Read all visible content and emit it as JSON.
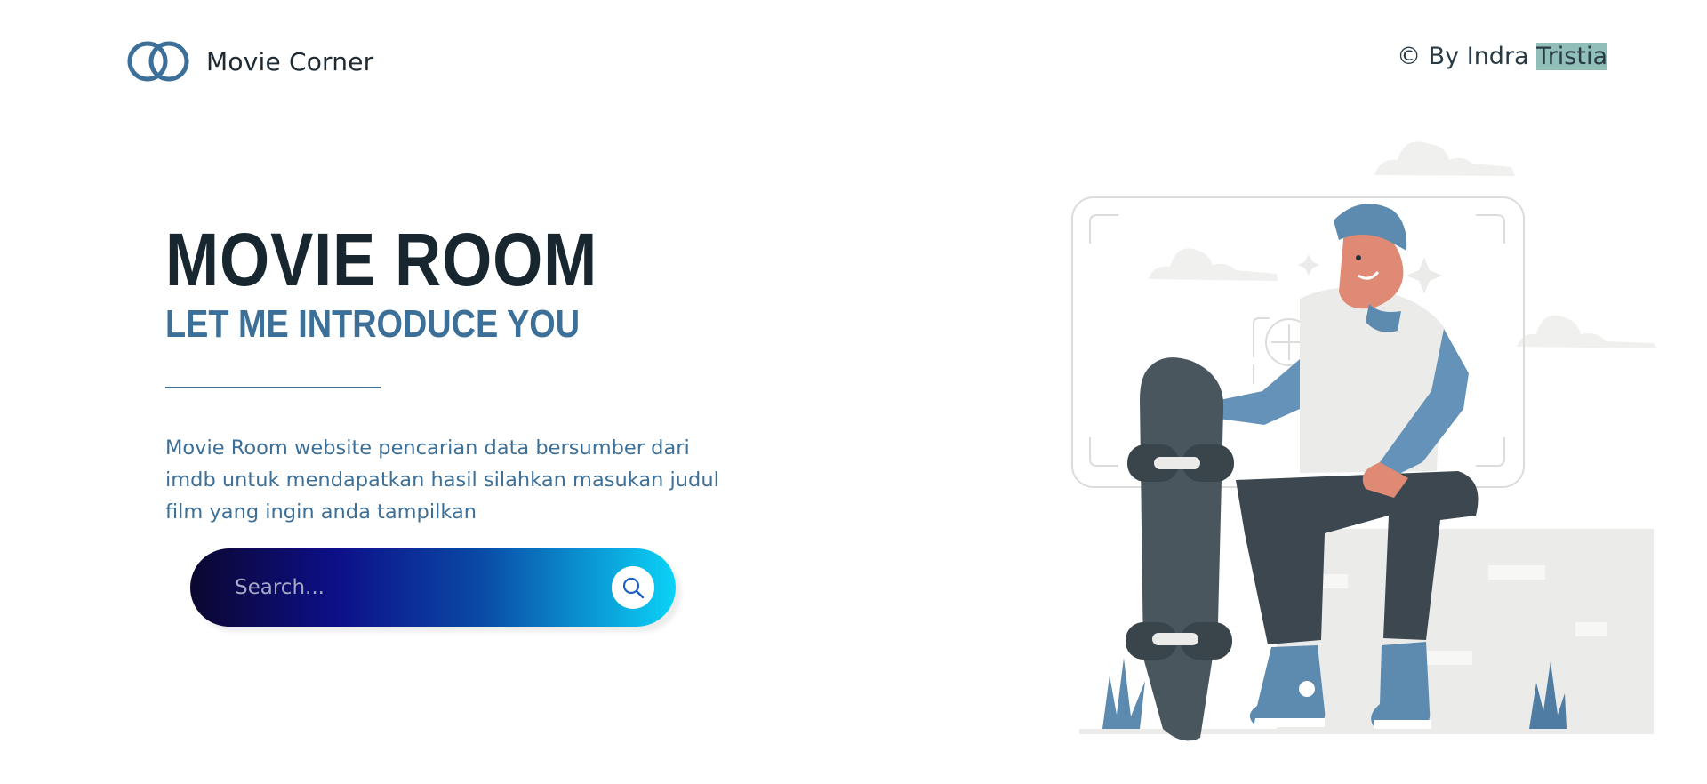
{
  "header": {
    "brand": "Movie Corner",
    "logo_icon": "interlocking-rings-icon",
    "credit_prefix": "© By Indra ",
    "credit_highlight": "Tristia"
  },
  "hero": {
    "title": "MOVIE ROOM",
    "subtitle": "LET ME INTRODUCE YOU",
    "description": "Movie Room website pencarian data bersumber dari imdb untuk mendapatkan hasil silahkan masukan judul film yang ingin anda tampilkan"
  },
  "search": {
    "placeholder": "Search...",
    "value": "",
    "button_icon": "search-icon"
  },
  "illustration": {
    "subject": "skater-with-skateboard-illustration"
  },
  "colors": {
    "title": "#17262f",
    "accent": "#3d7098",
    "highlight": "#8fbfb7",
    "search_gradient_start": "#0b0730",
    "search_gradient_end": "#0bd3f7"
  }
}
